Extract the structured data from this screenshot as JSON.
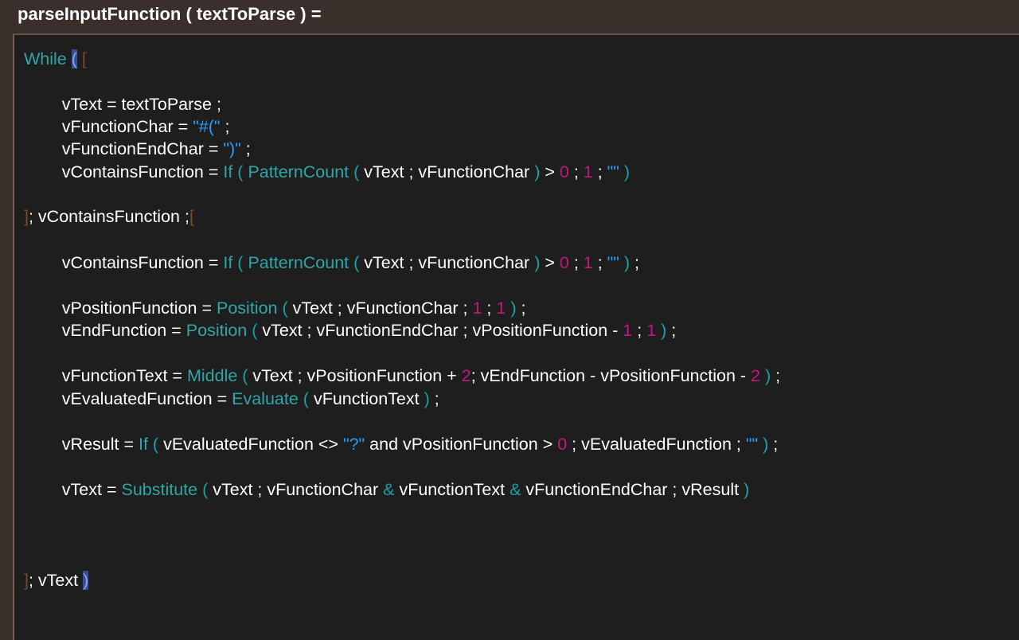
{
  "title": "parseInputFunction ( textToParse ) =",
  "editor": {
    "lines": [
      {
        "tokens": [
          [
            "k",
            "While "
          ],
          [
            "bh",
            "("
          ],
          [
            "t",
            " "
          ],
          [
            "b",
            "["
          ]
        ]
      },
      {
        "tokens": []
      },
      {
        "tokens": [
          [
            "t",
            "        vText = textToParse ;"
          ]
        ]
      },
      {
        "tokens": [
          [
            "t",
            "        vFunctionChar = "
          ],
          [
            "s",
            "\"#(\""
          ],
          [
            "t",
            " ;"
          ]
        ]
      },
      {
        "tokens": [
          [
            "t",
            "        vFunctionEndChar = "
          ],
          [
            "s",
            "\")\""
          ],
          [
            "t",
            " ;"
          ]
        ]
      },
      {
        "tokens": [
          [
            "t",
            "        vContainsFunction = "
          ],
          [
            "k",
            "If"
          ],
          [
            "t",
            " "
          ],
          [
            "p",
            "("
          ],
          [
            "t",
            " "
          ],
          [
            "k",
            "PatternCount"
          ],
          [
            "t",
            " "
          ],
          [
            "p",
            "("
          ],
          [
            "t",
            " vText ; vFunctionChar "
          ],
          [
            "p",
            ")"
          ],
          [
            "t",
            " > "
          ],
          [
            "n",
            "0"
          ],
          [
            "t",
            " ; "
          ],
          [
            "n",
            "1"
          ],
          [
            "t",
            " ; "
          ],
          [
            "s",
            "\"\""
          ],
          [
            "t",
            " "
          ],
          [
            "p",
            ")"
          ]
        ]
      },
      {
        "tokens": []
      },
      {
        "tokens": [
          [
            "b",
            "]"
          ],
          [
            "t",
            "; vContainsFunction ;"
          ],
          [
            "b",
            "["
          ]
        ]
      },
      {
        "tokens": []
      },
      {
        "tokens": [
          [
            "t",
            "        vContainsFunction = "
          ],
          [
            "k",
            "If"
          ],
          [
            "t",
            " "
          ],
          [
            "p",
            "("
          ],
          [
            "t",
            " "
          ],
          [
            "k",
            "PatternCount"
          ],
          [
            "t",
            " "
          ],
          [
            "p",
            "("
          ],
          [
            "t",
            " vText ; vFunctionChar "
          ],
          [
            "p",
            ")"
          ],
          [
            "t",
            " > "
          ],
          [
            "n",
            "0"
          ],
          [
            "t",
            " ; "
          ],
          [
            "n",
            "1"
          ],
          [
            "t",
            " ; "
          ],
          [
            "s",
            "\"\""
          ],
          [
            "t",
            " "
          ],
          [
            "p",
            ")"
          ],
          [
            "t",
            " ;"
          ]
        ]
      },
      {
        "tokens": []
      },
      {
        "tokens": [
          [
            "t",
            "        vPositionFunction = "
          ],
          [
            "k",
            "Position"
          ],
          [
            "t",
            " "
          ],
          [
            "p",
            "("
          ],
          [
            "t",
            " vText ; vFunctionChar ; "
          ],
          [
            "n",
            "1"
          ],
          [
            "t",
            " ; "
          ],
          [
            "n",
            "1"
          ],
          [
            "t",
            " "
          ],
          [
            "p",
            ")"
          ],
          [
            "t",
            " ;"
          ]
        ]
      },
      {
        "tokens": [
          [
            "t",
            "        vEndFunction = "
          ],
          [
            "k",
            "Position"
          ],
          [
            "t",
            " "
          ],
          [
            "p",
            "("
          ],
          [
            "t",
            " vText ; vFunctionEndChar ; vPositionFunction - "
          ],
          [
            "n",
            "1"
          ],
          [
            "t",
            " ; "
          ],
          [
            "n",
            "1"
          ],
          [
            "t",
            " "
          ],
          [
            "p",
            ")"
          ],
          [
            "t",
            " ;"
          ]
        ]
      },
      {
        "tokens": []
      },
      {
        "tokens": [
          [
            "t",
            "        vFunctionText = "
          ],
          [
            "k",
            "Middle"
          ],
          [
            "t",
            " "
          ],
          [
            "p",
            "("
          ],
          [
            "t",
            " vText ; vPositionFunction + "
          ],
          [
            "n",
            "2"
          ],
          [
            "t",
            "; vEndFunction - vPositionFunction - "
          ],
          [
            "n",
            "2"
          ],
          [
            "t",
            " "
          ],
          [
            "p",
            ")"
          ],
          [
            "t",
            " ;"
          ]
        ]
      },
      {
        "tokens": [
          [
            "t",
            "        vEvaluatedFunction = "
          ],
          [
            "k",
            "Evaluate"
          ],
          [
            "t",
            " "
          ],
          [
            "p",
            "("
          ],
          [
            "t",
            " vFunctionText "
          ],
          [
            "p",
            ")"
          ],
          [
            "t",
            " ;"
          ]
        ]
      },
      {
        "tokens": []
      },
      {
        "tokens": [
          [
            "t",
            "        vResult = "
          ],
          [
            "k",
            "If"
          ],
          [
            "t",
            " "
          ],
          [
            "p",
            "("
          ],
          [
            "t",
            " vEvaluatedFunction <> "
          ],
          [
            "s",
            "\"?\""
          ],
          [
            "t",
            " and vPositionFunction > "
          ],
          [
            "n",
            "0"
          ],
          [
            "t",
            " ; vEvaluatedFunction ; "
          ],
          [
            "s",
            "\"\""
          ],
          [
            "t",
            " "
          ],
          [
            "p",
            ")"
          ],
          [
            "t",
            " ;"
          ]
        ]
      },
      {
        "tokens": []
      },
      {
        "tokens": [
          [
            "t",
            "        vText = "
          ],
          [
            "k",
            "Substitute"
          ],
          [
            "t",
            " "
          ],
          [
            "p",
            "("
          ],
          [
            "t",
            " vText ; vFunctionChar "
          ],
          [
            "o",
            "&"
          ],
          [
            "t",
            " vFunctionText "
          ],
          [
            "o",
            "&"
          ],
          [
            "t",
            " vFunctionEndChar ; vResult "
          ],
          [
            "p",
            ")"
          ]
        ]
      },
      {
        "tokens": []
      },
      {
        "tokens": []
      },
      {
        "tokens": []
      },
      {
        "tokens": [
          [
            "b",
            "]"
          ],
          [
            "t",
            "; vText "
          ],
          [
            "bh",
            ")"
          ]
        ]
      }
    ]
  }
}
